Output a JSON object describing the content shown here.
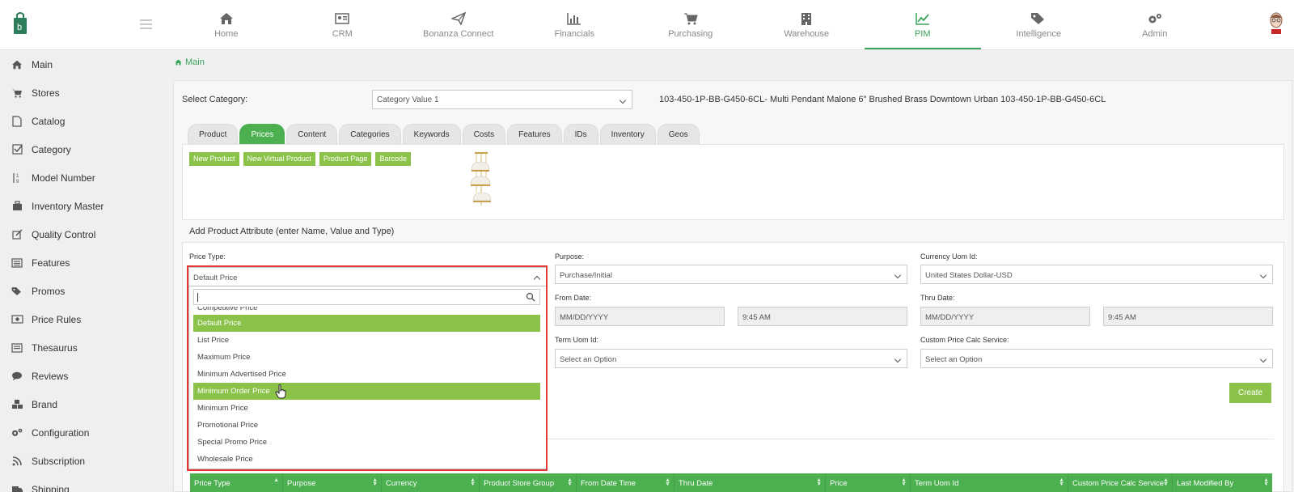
{
  "topnav": [
    {
      "label": "Home",
      "icon": "home-icon"
    },
    {
      "label": "CRM",
      "icon": "crm-icon"
    },
    {
      "label": "Bonanza Connect",
      "icon": "paper-plane-icon"
    },
    {
      "label": "Financials",
      "icon": "bar-chart-icon"
    },
    {
      "label": "Purchasing",
      "icon": "cart-icon"
    },
    {
      "label": "Warehouse",
      "icon": "building-icon"
    },
    {
      "label": "PIM",
      "icon": "line-chart-icon",
      "active": true
    },
    {
      "label": "Intelligence",
      "icon": "tags-icon"
    },
    {
      "label": "Admin",
      "icon": "gears-icon"
    }
  ],
  "sidebar": {
    "items": [
      {
        "label": "Main",
        "icon": "home-icon"
      },
      {
        "label": "Stores",
        "icon": "cart-icon"
      },
      {
        "label": "Catalog",
        "icon": "file-icon"
      },
      {
        "label": "Category",
        "icon": "checkbox-icon"
      },
      {
        "label": "Model Number",
        "icon": "sort-numeric-icon"
      },
      {
        "label": "Inventory Master",
        "icon": "suitcase-icon"
      },
      {
        "label": "Quality Control",
        "icon": "edit-icon"
      },
      {
        "label": "Features",
        "icon": "list-icon"
      },
      {
        "label": "Promos",
        "icon": "tag-icon"
      },
      {
        "label": "Price Rules",
        "icon": "money-icon"
      },
      {
        "label": "Thesaurus",
        "icon": "book-icon"
      },
      {
        "label": "Reviews",
        "icon": "comment-icon"
      },
      {
        "label": "Brand",
        "icon": "cubes-icon"
      },
      {
        "label": "Configuration",
        "icon": "gears-icon"
      },
      {
        "label": "Subscription",
        "icon": "rss-icon"
      },
      {
        "label": "Shipping",
        "icon": "truck-icon"
      }
    ]
  },
  "breadcrumb": {
    "label": "Main"
  },
  "category": {
    "label": "Select Category:",
    "value": "Category Value 1"
  },
  "product_title": "103-450-1P-BB-G450-6CL- Multi Pendant Malone 6\" Brushed Brass Downtown Urban 103-450-1P-BB-G450-6CL",
  "tabs": [
    "Product",
    "Prices",
    "Content",
    "Categories",
    "Keywords",
    "Costs",
    "Features",
    "IDs",
    "Inventory",
    "Geos"
  ],
  "active_tab": "Prices",
  "action_buttons": [
    "New Product",
    "New Virtual Product",
    "Product Page",
    "Barcode"
  ],
  "attr_header": "Add Product Attribute (enter Name, Value and Type)",
  "form": {
    "price_type_label": "Price Type:",
    "price_type_value": "Default Price",
    "purpose_label": "Purpose:",
    "purpose_value": "Purchase/Initial",
    "currency_label": "Currency Uom Id:",
    "currency_value": "United States Dollar-USD",
    "from_date_label": "From Date:",
    "from_date_placeholder": "MM/DD/YYYY",
    "from_time": "9:45 AM",
    "thru_date_label": "Thru Date:",
    "thru_date_placeholder": "MM/DD/YYYY",
    "thru_time": "9:45 AM",
    "term_uom_label": "Term Uom Id:",
    "term_uom_value": "Select an Option",
    "calc_service_label": "Custom Price Calc Service:",
    "calc_service_value": "Select an Option",
    "create_label": "Create"
  },
  "dropdown": {
    "search_value": "",
    "options": [
      {
        "label": "Competitive Price",
        "state": "cut"
      },
      {
        "label": "Default Price",
        "state": "selected"
      },
      {
        "label": "List Price"
      },
      {
        "label": "Maximum Price"
      },
      {
        "label": "Minimum Advertised Price"
      },
      {
        "label": "Minimum Order Price",
        "state": "hover"
      },
      {
        "label": "Minimum Price"
      },
      {
        "label": "Promotional Price"
      },
      {
        "label": "Special Promo Price"
      },
      {
        "label": "Wholesale Price"
      }
    ]
  },
  "table": {
    "columns": [
      "Price Type",
      "Purpose",
      "Currency",
      "Product Store Group",
      "From Date Time",
      "Thru Date",
      "Price",
      "Term Uom Id",
      "Custom Price Calc Service",
      "Last Modified By"
    ]
  },
  "colors": {
    "accent": "#4caf50",
    "button_green": "#8bc34a",
    "highlight_red": "#e53935"
  }
}
